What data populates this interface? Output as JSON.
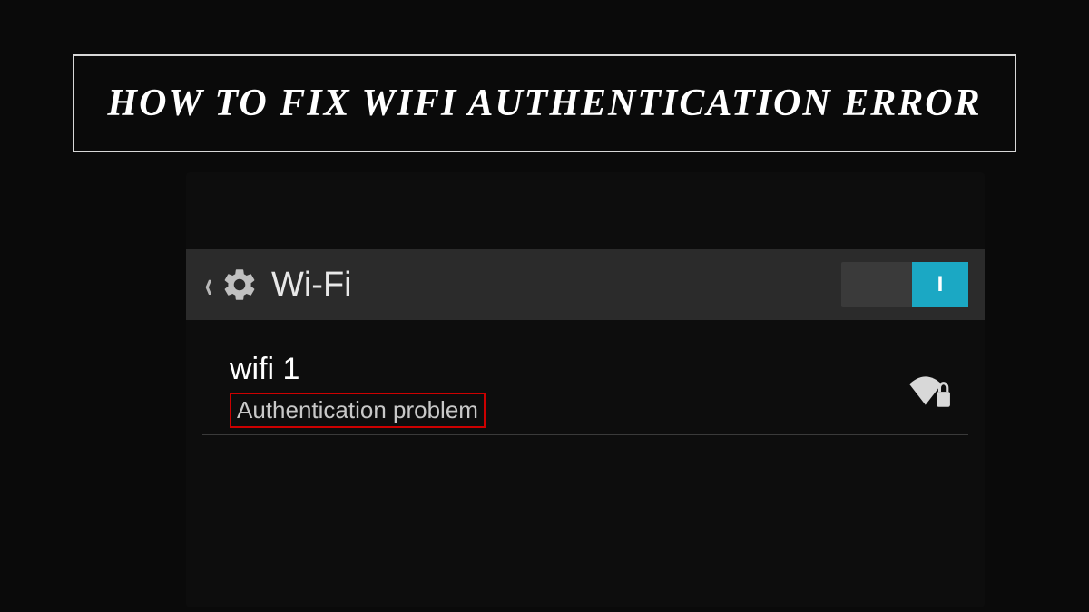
{
  "title": "HOW TO FIX WIFI AUTHENTICATION ERROR",
  "header": {
    "label": "Wi-Fi",
    "toggle_state": "I"
  },
  "network": {
    "name": "wifi 1",
    "status": "Authentication problem"
  }
}
